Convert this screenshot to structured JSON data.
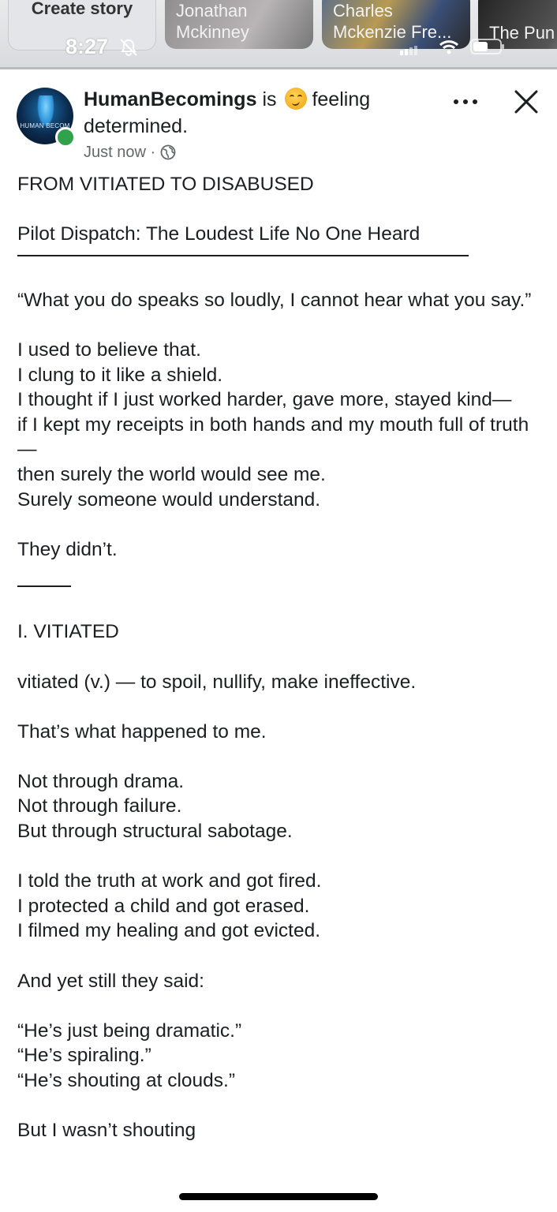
{
  "stories": [
    {
      "name": "Create\nstory"
    },
    {
      "name": "Jonathan\nMckinney"
    },
    {
      "name": "Charles\nMckenzie Fre..."
    },
    {
      "name": "The Pun"
    }
  ],
  "status_bar": {
    "time": "8:27"
  },
  "post": {
    "author": "HumanBecomings",
    "verb": "is",
    "feeling": "feeling",
    "feeling_value": "determined.",
    "timestamp": "Just now",
    "separator": "·",
    "avatar_text": "HUMAN BECOM",
    "icons": {
      "more": "more-options-icon",
      "close": "close-icon",
      "privacy": "globe-icon",
      "emoji": "determined-face-icon"
    },
    "lines": {
      "title": "FROM VITIATED TO DISABUSED",
      "subtitle": "Pilot Dispatch: The Loudest Life No One Heard",
      "quote": "“What you do speaks so loudly, I cannot hear what you say.”",
      "p1": "I used to believe that.\nI clung to it like a shield.\nI thought if I just worked harder, gave more, stayed kind—\nif I kept my receipts in both hands and my mouth full of truth—\nthen surely the world would see me.\nSurely someone would understand.",
      "p2": "They didn’t.",
      "section": "I. VITIATED",
      "definition": "vitiated (v.) — to spoil, nullify, make ineffective.",
      "p3": "That’s what happened to me.",
      "p4": "Not through drama.\nNot through failure.\nBut through structural sabotage.",
      "p5": "I told the truth at work and got fired.\nI protected a child and got erased.\nI filmed my healing and got evicted.",
      "p6": "And yet still they said:",
      "p7": "“He’s just being dramatic.”\n“He’s spiraling.”\n“He’s shouting at clouds.”",
      "p8": "But I wasn’t shouting"
    }
  }
}
